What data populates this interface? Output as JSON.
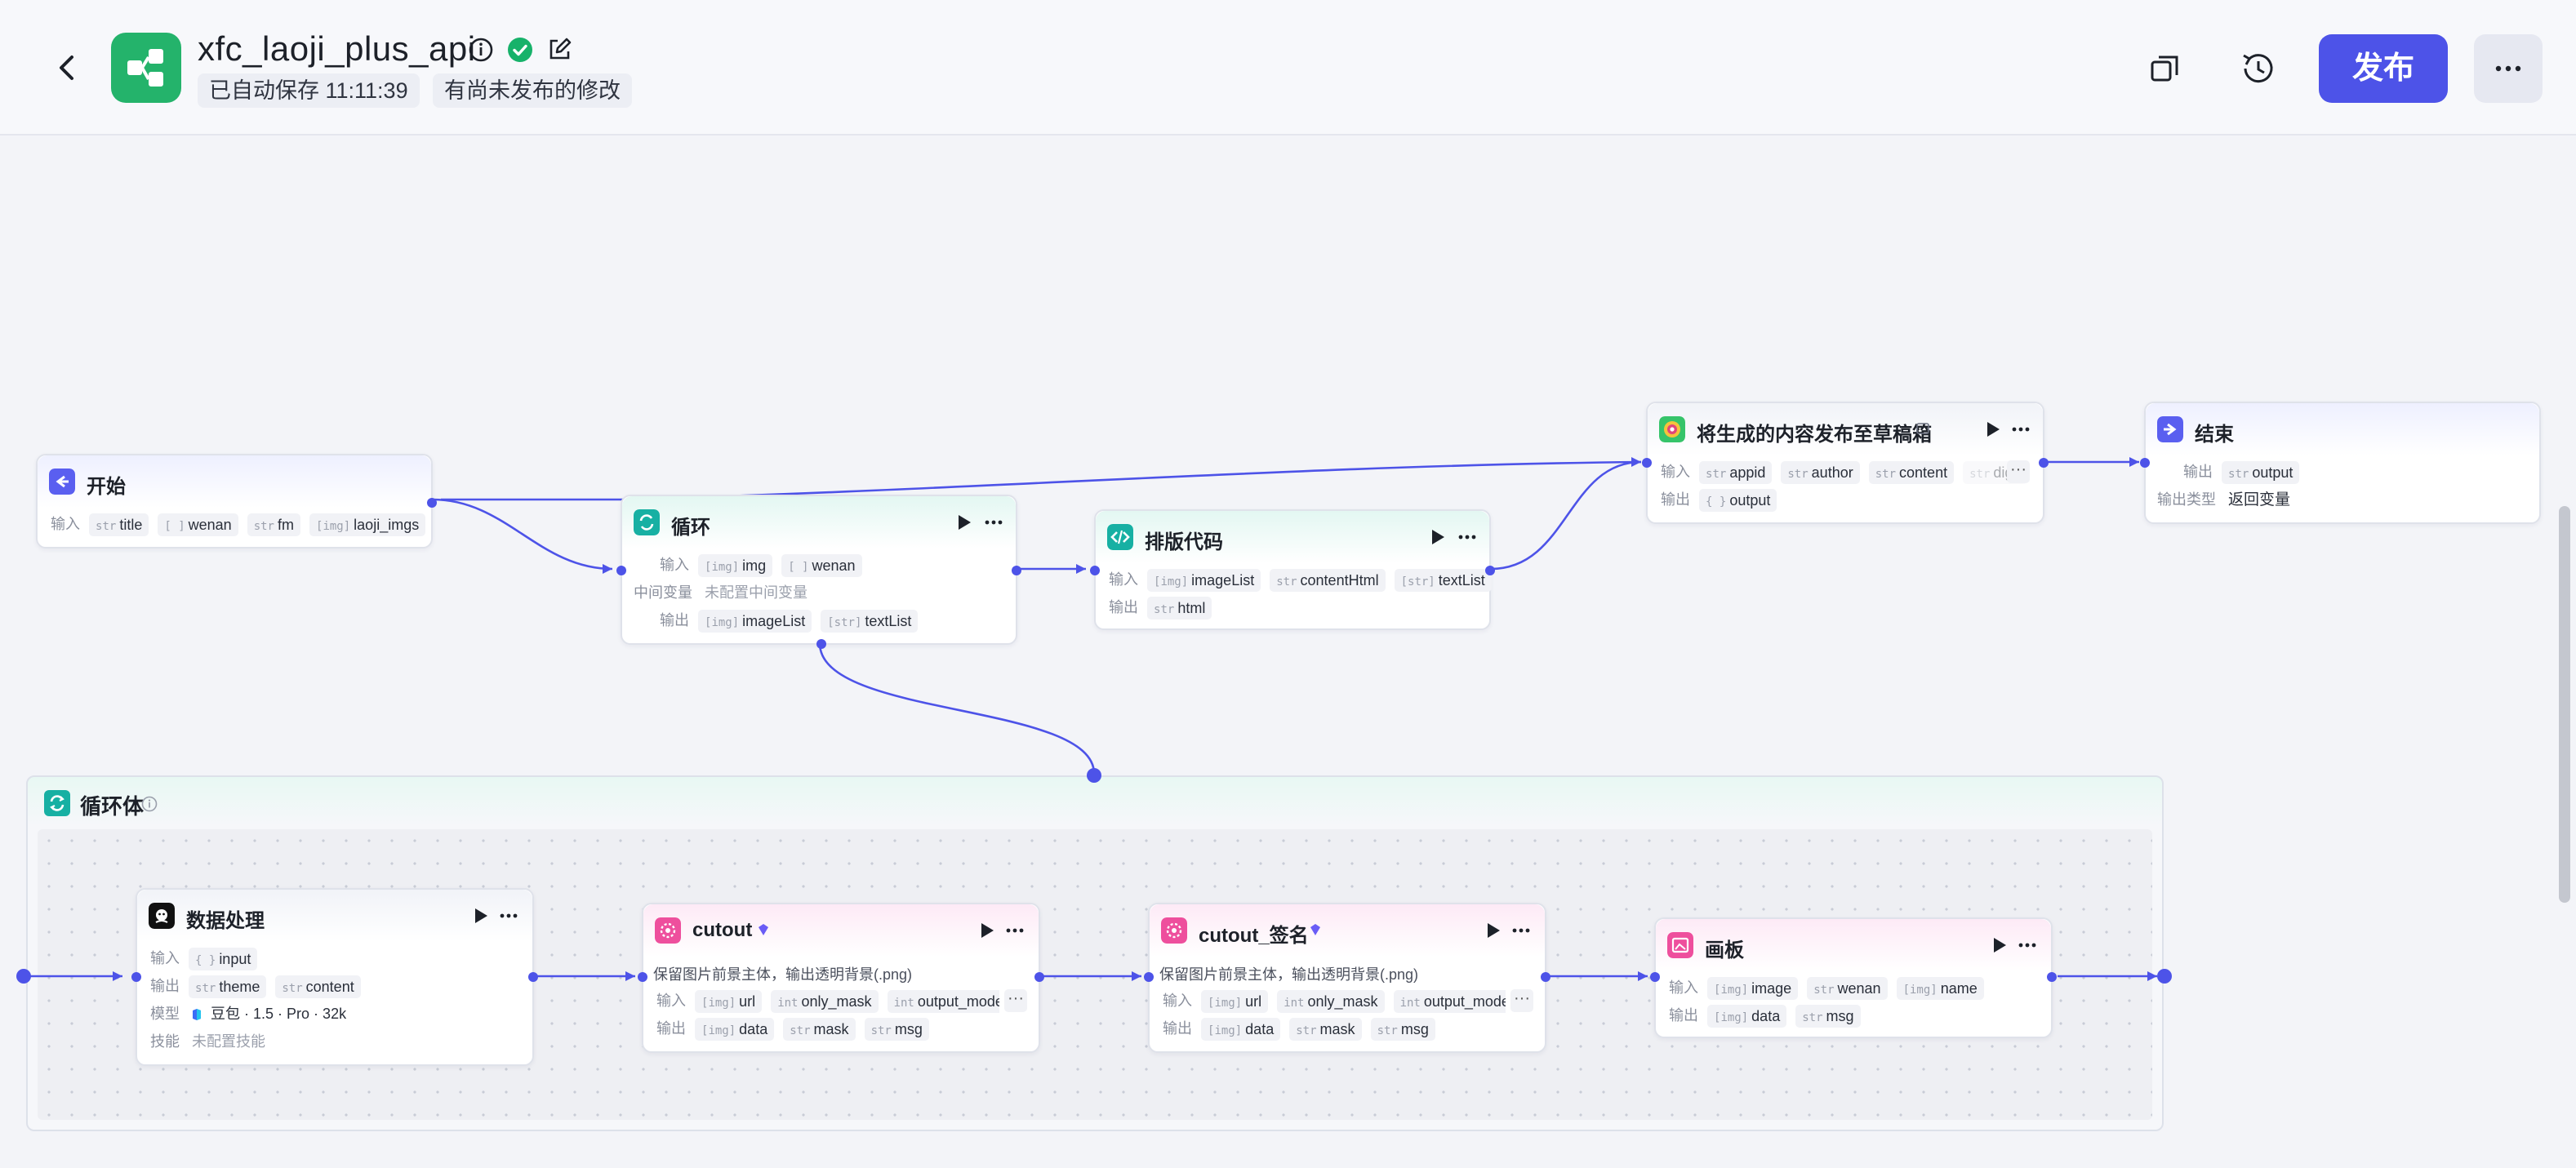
{
  "header": {
    "app_title": "xfc_laoji_plus_api",
    "autosave": "已自动保存 11:11:39",
    "unpublished": "有尚未发布的修改",
    "publish_label": "发布"
  },
  "colors": {
    "accent": "#4d53e8",
    "edge": "#4d53e8",
    "logo": "#24b36b"
  },
  "nodes": {
    "start": {
      "title": "开始",
      "input_label": "输入",
      "inputs": [
        {
          "type": "str",
          "name": "title"
        },
        {
          "type": "[ ]",
          "name": "wenan"
        },
        {
          "type": "str",
          "name": "fm"
        },
        {
          "type": "[img]",
          "name": "laoji_imgs"
        }
      ]
    },
    "loop": {
      "title": "循环",
      "input_label": "输入",
      "inputs": [
        {
          "type": "[img]",
          "name": "img"
        },
        {
          "type": "[ ]",
          "name": "wenan"
        }
      ],
      "mid_label": "中间变量",
      "mid_value": "未配置中间变量",
      "output_label": "输出",
      "outputs": [
        {
          "type": "[img]",
          "name": "imageList"
        },
        {
          "type": "[str]",
          "name": "textList"
        }
      ]
    },
    "layout_code": {
      "title": "排版代码",
      "input_label": "输入",
      "inputs": [
        {
          "type": "[img]",
          "name": "imageList"
        },
        {
          "type": "str",
          "name": "contentHtml"
        },
        {
          "type": "[str]",
          "name": "textList"
        }
      ],
      "output_label": "输出",
      "outputs": [
        {
          "type": "str",
          "name": "html"
        }
      ]
    },
    "publish_draft": {
      "title": "将生成的内容发布至草稿箱",
      "input_label": "输入",
      "inputs": [
        {
          "type": "str",
          "name": "appid"
        },
        {
          "type": "str",
          "name": "author"
        },
        {
          "type": "str",
          "name": "content"
        },
        {
          "type": "str",
          "name": "dige"
        }
      ],
      "output_label": "输出",
      "outputs": [
        {
          "type": "{ }",
          "name": "output"
        }
      ]
    },
    "end": {
      "title": "结束",
      "output_label": "输出",
      "outputs": [
        {
          "type": "str",
          "name": "output"
        }
      ],
      "output_type_label": "输出类型",
      "output_type_value": "返回变量"
    },
    "loop_body": {
      "title": "循环体"
    },
    "data_proc": {
      "title": "数据处理",
      "input_label": "输入",
      "inputs": [
        {
          "type": "{ }",
          "name": "input"
        }
      ],
      "output_label": "输出",
      "outputs": [
        {
          "type": "str",
          "name": "theme"
        },
        {
          "type": "str",
          "name": "content"
        }
      ],
      "model_label": "模型",
      "model_value": "豆包 · 1.5 · Pro · 32k",
      "skill_label": "技能",
      "skill_value": "未配置技能"
    },
    "cutout": {
      "title": "cutout",
      "desc": "保留图片前景主体，输出透明背景(.png)",
      "input_label": "输入",
      "inputs": [
        {
          "type": "[img]",
          "name": "url"
        },
        {
          "type": "int",
          "name": "only_mask"
        },
        {
          "type": "int",
          "name": "output_mode"
        }
      ],
      "output_label": "输出",
      "outputs": [
        {
          "type": "[img]",
          "name": "data"
        },
        {
          "type": "str",
          "name": "mask"
        },
        {
          "type": "str",
          "name": "msg"
        }
      ]
    },
    "cutout_sign": {
      "title": "cutout_签名",
      "desc": "保留图片前景主体，输出透明背景(.png)",
      "input_label": "输入",
      "inputs": [
        {
          "type": "[img]",
          "name": "url"
        },
        {
          "type": "int",
          "name": "only_mask"
        },
        {
          "type": "int",
          "name": "output_mode"
        }
      ],
      "output_label": "输出",
      "outputs": [
        {
          "type": "[img]",
          "name": "data"
        },
        {
          "type": "str",
          "name": "mask"
        },
        {
          "type": "str",
          "name": "msg"
        }
      ]
    },
    "canvas_board": {
      "title": "画板",
      "input_label": "输入",
      "inputs": [
        {
          "type": "[img]",
          "name": "image"
        },
        {
          "type": "str",
          "name": "wenan"
        },
        {
          "type": "[img]",
          "name": "name"
        }
      ],
      "output_label": "输出",
      "outputs": [
        {
          "type": "[img]",
          "name": "data"
        },
        {
          "type": "str",
          "name": "msg"
        }
      ]
    }
  }
}
